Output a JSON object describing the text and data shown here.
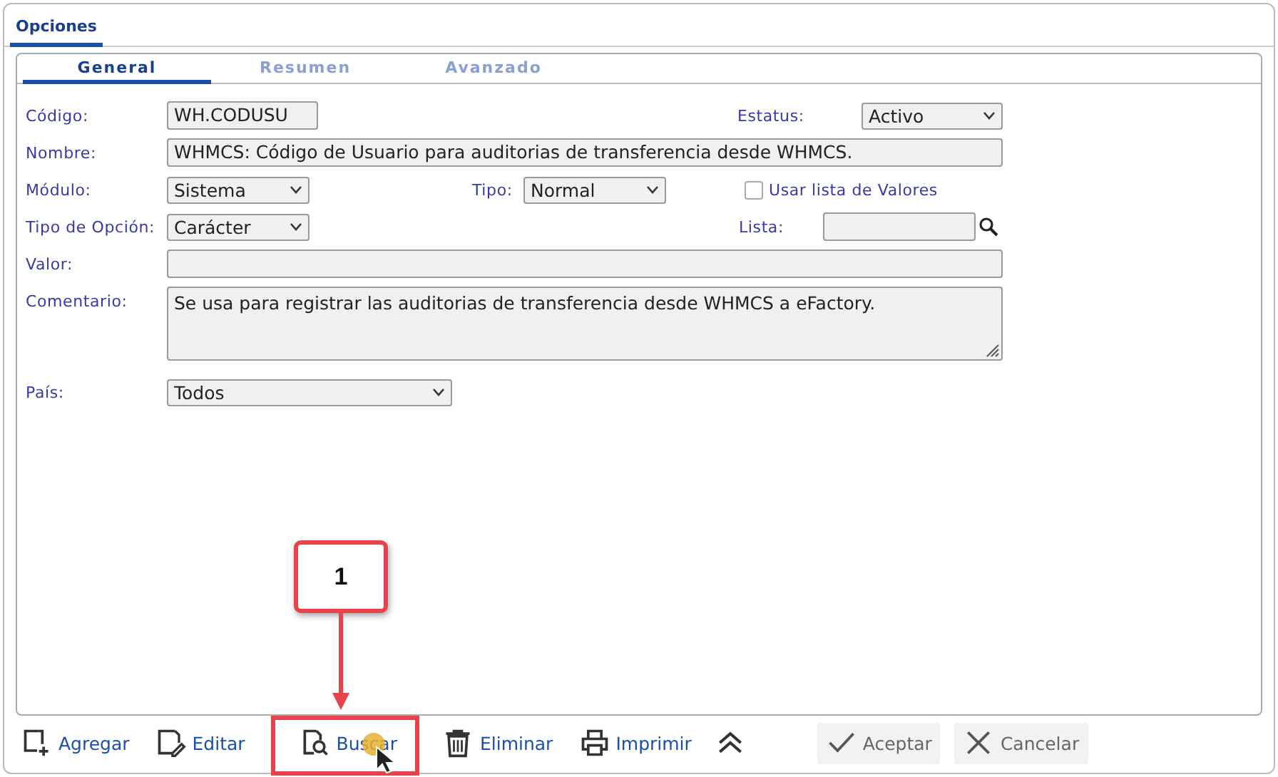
{
  "tabs": [
    {
      "label": "Opciones",
      "selected": true
    }
  ],
  "subtabs": [
    {
      "label": "General",
      "selected": true
    },
    {
      "label": "Resumen",
      "selected": false
    },
    {
      "label": "Avanzado",
      "selected": false
    }
  ],
  "form": {
    "codigo": {
      "label": "Código:",
      "value": "WH.CODUSU"
    },
    "estatus": {
      "label": "Estatus:",
      "value": "Activo"
    },
    "nombre": {
      "label": "Nombre:",
      "value": "WHMCS: Código de Usuario para auditorias de transferencia desde WHMCS."
    },
    "modulo": {
      "label": "Módulo:",
      "value": "Sistema"
    },
    "tipo": {
      "label": "Tipo:",
      "value": "Normal"
    },
    "usar_lista": {
      "label": "Usar lista de Valores",
      "checked": false
    },
    "tipo_opcion": {
      "label": "Tipo de Opción:",
      "value": "Carácter"
    },
    "lista": {
      "label": "Lista:"
    },
    "valor": {
      "label": "Valor:"
    },
    "comentario": {
      "label": "Comentario:",
      "value": "Se usa para registrar las auditorias de transferencia desde WHMCS a eFactory."
    },
    "pais": {
      "label": "País:",
      "value": "Todos"
    }
  },
  "toolbar": [
    {
      "kind": "add",
      "label": "Agregar"
    },
    {
      "kind": "edit",
      "label": "Editar"
    },
    {
      "kind": "search",
      "label": "Buscar"
    },
    {
      "kind": "delete",
      "label": "Eliminar"
    },
    {
      "kind": "print",
      "label": "Imprimir"
    },
    {
      "kind": "collapse"
    }
  ],
  "actions": [
    {
      "kind": "accept",
      "label": "Aceptar"
    },
    {
      "kind": "cancel",
      "label": "Cancelar"
    }
  ],
  "annotation": {
    "label": "1"
  }
}
